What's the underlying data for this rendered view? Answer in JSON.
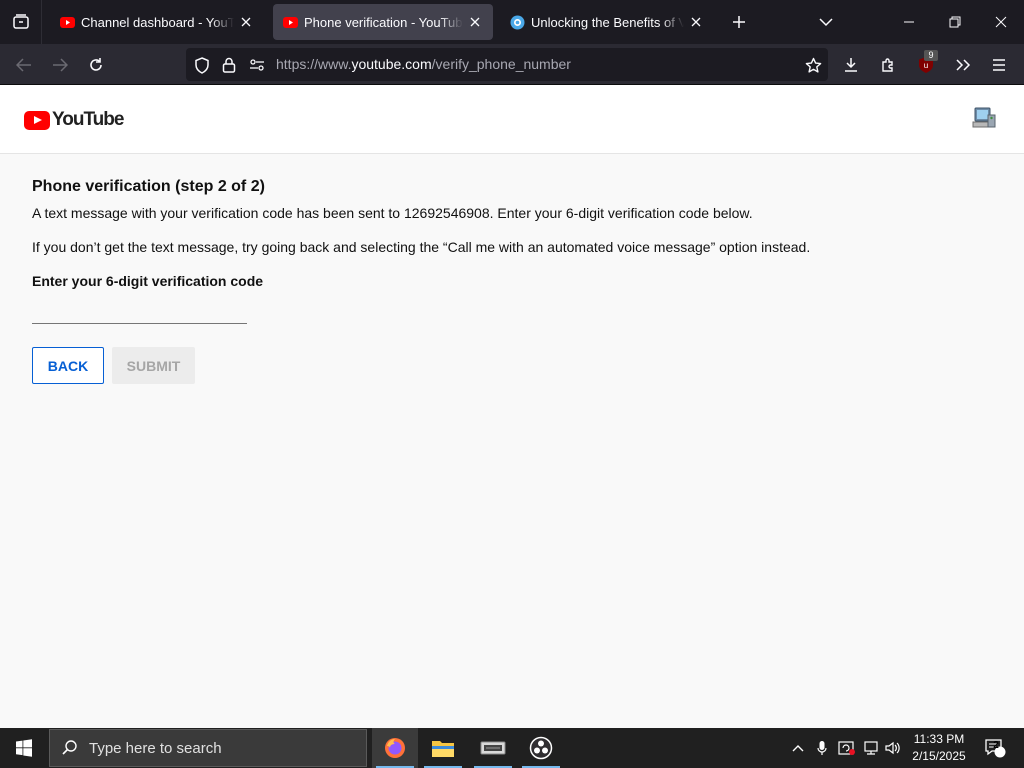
{
  "browser": {
    "tabs": [
      {
        "title": "Channel dashboard - YouTube Studio",
        "active": false
      },
      {
        "title": "Phone verification - YouTube",
        "active": true
      },
      {
        "title": "Unlocking the Benefits of Virtual",
        "active": false
      }
    ],
    "url": {
      "prefix": "https://www.",
      "host": "youtube.com",
      "path": "/verify_phone_number"
    },
    "extension_badge": "9"
  },
  "page": {
    "logo_text": "YouTube",
    "title": "Phone verification (step 2 of 2)",
    "message1": "A text message with your verification code has been sent to 12692546908. Enter your 6-digit verification code below.",
    "message2": "If you don’t get the text message, try going back and selecting the “Call me with an automated voice message” option instead.",
    "code_label": "Enter your 6-digit verification code",
    "code_value": "",
    "back_label": "BACK",
    "submit_label": "SUBMIT"
  },
  "taskbar": {
    "search_placeholder": "Type here to search",
    "time": "11:33 PM",
    "date": "2/15/2025",
    "notifications": "2"
  },
  "colors": {
    "youtube_red": "#ff0000",
    "link_blue": "#065fd4",
    "browser_dark": "#1c1b22",
    "active_tab": "#42414d",
    "taskbar": "#202020"
  }
}
